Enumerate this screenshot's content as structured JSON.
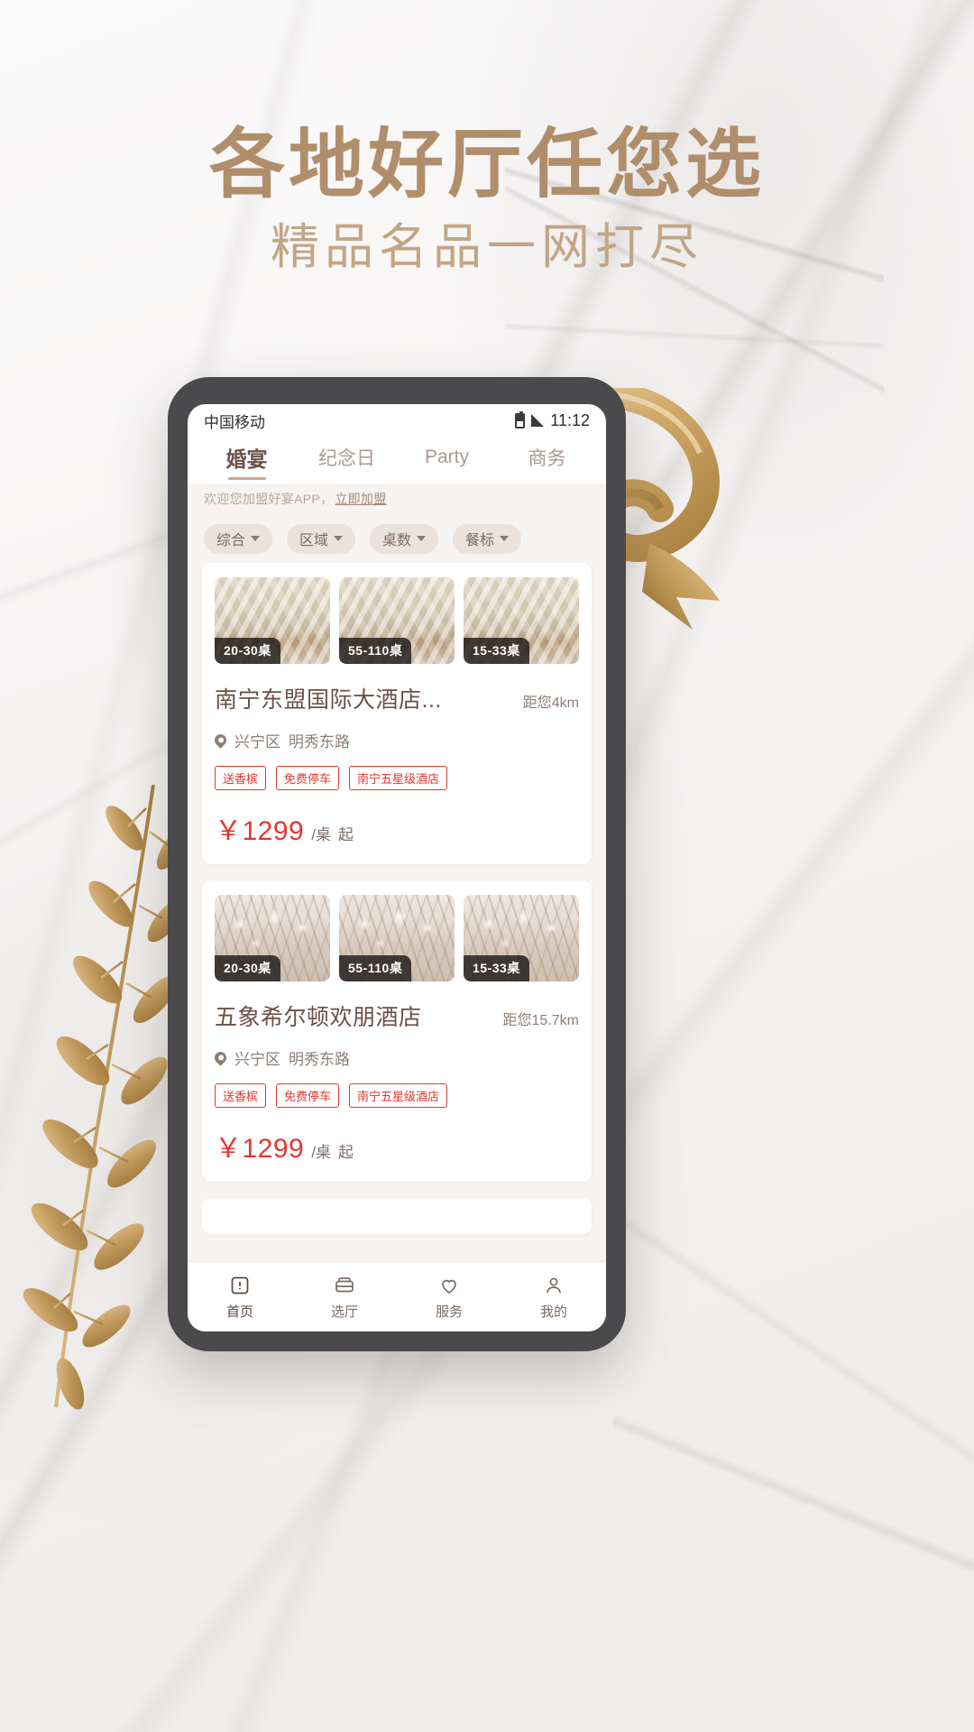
{
  "poster": {
    "headline": "各地好厅任您选",
    "subline": "精品名品一网打尽",
    "accent_color": "#b08e6b",
    "sub_color": "#c2a585",
    "background": "white-marble"
  },
  "decor": {
    "ribbon": "gold-ribbon",
    "branch": "gold-botanical-branch"
  },
  "phone": {
    "statusbar": {
      "carrier": "中国移动",
      "time": "11:12",
      "battery_icon": "battery-icon",
      "signal_icon": "signal-icon"
    },
    "tabs": [
      {
        "label": "婚宴",
        "active": true
      },
      {
        "label": "纪念日",
        "active": false
      },
      {
        "label": "Party",
        "active": false
      },
      {
        "label": "商务",
        "active": false
      }
    ],
    "promo": {
      "text": "欢迎您加盟好宴APP，",
      "link": "立即加盟"
    },
    "filters": [
      {
        "label": "综合"
      },
      {
        "label": "区域"
      },
      {
        "label": "桌数"
      },
      {
        "label": "餐标"
      }
    ],
    "cards": [
      {
        "thumbs": [
          {
            "style": "hall",
            "badge": "20-30桌"
          },
          {
            "style": "hall",
            "badge": "55-110桌"
          },
          {
            "style": "hall",
            "badge": "15-33桌"
          }
        ],
        "name": "南宁东盟国际大酒店...",
        "distance": "距您4km",
        "district": "兴宁区",
        "street": "明秀东路",
        "tags": [
          "送香槟",
          "免费停车",
          "南宁五星级酒店"
        ],
        "price": "￥1299",
        "unit": "/桌",
        "from": "起"
      },
      {
        "thumbs": [
          {
            "style": "flower",
            "badge": "20-30桌"
          },
          {
            "style": "flower",
            "badge": "55-110桌"
          },
          {
            "style": "flower",
            "badge": "15-33桌"
          }
        ],
        "name": "五象希尔顿欢朋酒店",
        "distance": "距您15.7km",
        "district": "兴宁区",
        "street": "明秀东路",
        "tags": [
          "送香槟",
          "免费停车",
          "南宁五星级酒店"
        ],
        "price": "￥1299",
        "unit": "/桌",
        "from": "起"
      }
    ],
    "bottomnav": [
      {
        "label": "首页",
        "icon": "home-icon",
        "active": true
      },
      {
        "label": "选厅",
        "icon": "hall-icon",
        "active": false
      },
      {
        "label": "服务",
        "icon": "heart-icon",
        "active": false
      },
      {
        "label": "我的",
        "icon": "person-icon",
        "active": false
      }
    ],
    "colors": {
      "price_red": "#e2362f",
      "tab_active": "#6d514a",
      "chip_bg": "#ece2dc"
    }
  }
}
